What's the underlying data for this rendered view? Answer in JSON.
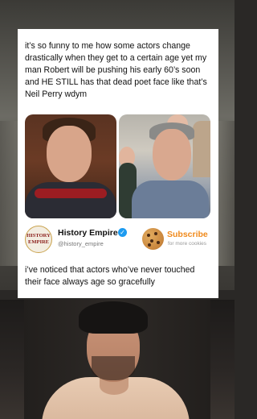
{
  "tweet": {
    "text": "it’s so funny to me how some actors change drastically when they get to a certain age yet my man Robert will be pushing his early 60’s soon and HE STILL has that dead poet face like that’s Neil Perry wdym"
  },
  "source": {
    "logo_line1": "HISTORY",
    "logo_line2": "EMPIRE",
    "name": "History Empire",
    "verified_icon": "verified-badge-icon",
    "handle": "@history_empire",
    "subscribe_label": "Subscribe",
    "subscribe_sub": "for more cookies",
    "cookie_icon": "cookie-icon"
  },
  "reply": {
    "text": "i’ve noticed that actors who’ve never touched their face always age so gracefully"
  },
  "colors": {
    "subscribe_accent": "#f08a1c",
    "verified_blue": "#1d9bf0",
    "logo_red": "#8a1d1a"
  }
}
